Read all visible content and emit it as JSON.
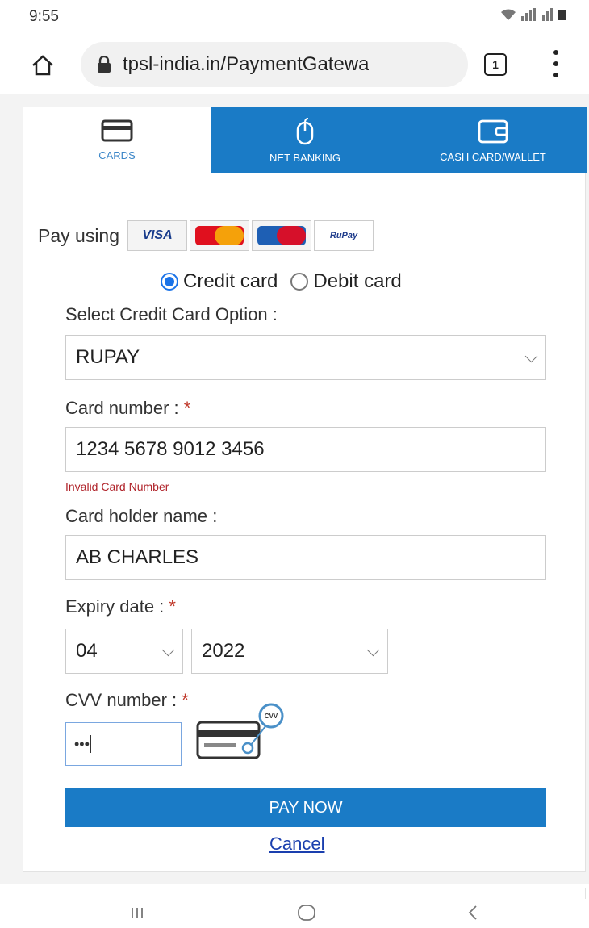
{
  "status": {
    "time": "9:55"
  },
  "browser": {
    "url": "tpsl-india.in/PaymentGatewa",
    "tab_count": "1"
  },
  "tabs": [
    {
      "label": "CARDS",
      "icon": "card-icon",
      "active": true
    },
    {
      "label": "NET BANKING",
      "icon": "mouse-icon",
      "active": false
    },
    {
      "label": "CASH CARD/WALLET",
      "icon": "wallet-icon",
      "active": false
    }
  ],
  "pay_using": {
    "label": "Pay using",
    "logos": [
      {
        "text": "VISA"
      },
      {
        "text": "MasterCard"
      },
      {
        "text": "Maestro"
      },
      {
        "text": "RuPay"
      }
    ]
  },
  "card_type": {
    "credit": "Credit card",
    "debit": "Debit card",
    "selected": "credit"
  },
  "form": {
    "option_label": "Select Credit Card Option :",
    "option_value": "RUPAY",
    "card_number_label": "Card number :",
    "card_number_value": "1234 5678 9012 3456",
    "card_number_error": "Invalid Card Number",
    "holder_label": "Card holder name :",
    "holder_value": "AB CHARLES",
    "expiry_label": "Expiry date :",
    "expiry_month": "04",
    "expiry_year": "2022",
    "cvv_label": "CVV number :",
    "cvv_value": "•••",
    "cvv_hint": "CVV",
    "required_mark": "*"
  },
  "actions": {
    "pay": "PAY NOW",
    "cancel": "Cancel"
  },
  "colors": {
    "primary": "#1a7bc6",
    "error": "#b0232a",
    "link": "#1a3fae"
  }
}
